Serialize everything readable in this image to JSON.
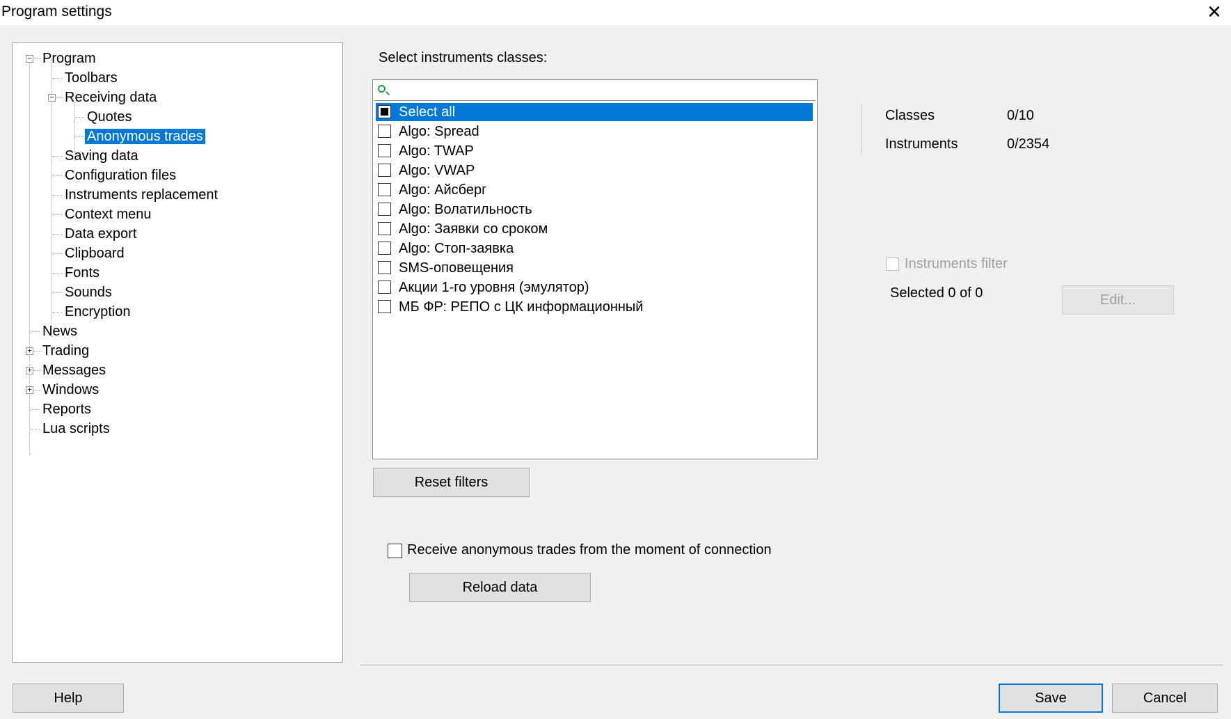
{
  "window": {
    "title": "Program settings",
    "close_glyph": "✕"
  },
  "tree": {
    "program": "Program",
    "toolbars": "Toolbars",
    "receiving_data": "Receiving data",
    "quotes": "Quotes",
    "anonymous_trades": "Anonymous trades",
    "saving_data": "Saving data",
    "configuration_files": "Configuration files",
    "instruments_replacement": "Instruments replacement",
    "context_menu": "Context menu",
    "data_export": "Data export",
    "clipboard": "Clipboard",
    "fonts": "Fonts",
    "sounds": "Sounds",
    "encryption": "Encryption",
    "news": "News",
    "trading": "Trading",
    "messages": "Messages",
    "windows": "Windows",
    "reports": "Reports",
    "lua_scripts": "Lua scripts",
    "expanded_glyph": "−",
    "collapsed_glyph": "+"
  },
  "classes": {
    "label": "Select instruments classes:",
    "search_placeholder": "",
    "items": [
      "Select all",
      "Algo: Spread",
      "Algo: TWAP",
      "Algo: VWAP",
      "Algo: Айсберг",
      "Algo: Волатильность",
      "Algo: Заявки со сроком",
      "Algo: Стоп-заявка",
      "SMS-оповещения",
      "Акции 1-го уровня (эмулятор)",
      "МБ ФР: РЕПО с ЦК информационный"
    ]
  },
  "stats": {
    "classes_label": "Classes",
    "classes_value": "0/10",
    "instruments_label": "Instruments",
    "instruments_value": "0/2354"
  },
  "filter": {
    "checkbox_label": "Instruments filter",
    "selected_text": "Selected 0 of 0",
    "edit_label": "Edit..."
  },
  "buttons": {
    "reset_filters": "Reset filters",
    "receive_label": "Receive anonymous trades from the moment of connection",
    "reload_data": "Reload data",
    "help": "Help",
    "save": "Save",
    "cancel": "Cancel"
  },
  "colors": {
    "selection": "#0078d7",
    "search_icon": "#1e9c3c"
  }
}
